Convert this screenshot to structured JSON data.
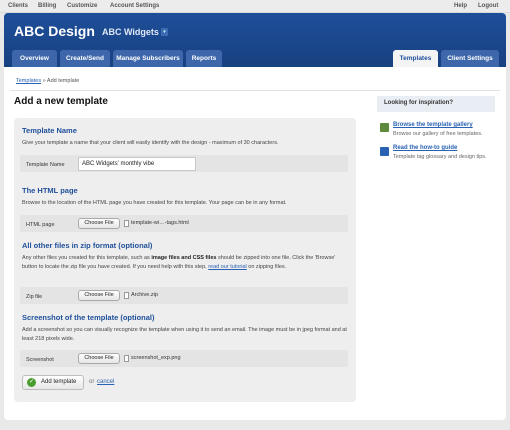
{
  "topnav": {
    "items": [
      "Clients",
      "Billing",
      "Customize",
      "Account Settings"
    ],
    "help": "Help",
    "logout": "Logout"
  },
  "header": {
    "title": "ABC Design",
    "client": "ABC Widgets"
  },
  "tabs": {
    "overview": "Overview",
    "create_send": "Create/Send",
    "manage_subscribers": "Manage Subscribers",
    "reports": "Reports",
    "templates": "Templates",
    "client_settings": "Client Settings"
  },
  "breadcrumb": {
    "parent": "Templates",
    "sep": "»",
    "current": "Add template"
  },
  "page": {
    "title": "Add a new template"
  },
  "form": {
    "name": {
      "heading": "Template Name",
      "help": "Give your template a name that your client will easily identify with the design - maximum of 30 characters.",
      "label": "Template Name",
      "value": "ABC Widgets' monthly vibe"
    },
    "html": {
      "heading": "The HTML page",
      "help": "Browse to the location of the HTML page you have created for this template. Your page can be in any format.",
      "label": "HTML page",
      "button": "Choose File",
      "filename": "template-wi…-tags.html"
    },
    "zip": {
      "heading": "All other files in zip format (optional)",
      "help_1": "Any other files you created for this template, such as ",
      "help_b1": "image files and CSS files",
      "help_2": " should be zipped into one file. Click the 'Browse' button to locate the zip file you have created. If you need help with this step, ",
      "help_link": "read our tutorial",
      "help_3": " on zipping files.",
      "label": "Zip file",
      "button": "Choose File",
      "filename": "Archive.zip"
    },
    "screenshot": {
      "heading": "Screenshot of the template (optional)",
      "help": "Add a screenshot so you can visually recognize the template when using it to send an email. The image must be in jpeg format and at least 218 pixels wide.",
      "label": "Screenshot",
      "button": "Choose File",
      "filename": "screenshot_exp.png"
    },
    "submit": "Add template",
    "or": "or",
    "cancel": "cancel"
  },
  "sidebar": {
    "heading": "Looking for inspiration?",
    "links": [
      {
        "label": "Browse the template gallery",
        "desc": "Browse our gallery of free templates."
      },
      {
        "label": "Read the how-to guide",
        "desc": "Template tag glossary and design tips."
      }
    ]
  },
  "colors": {
    "brand": "#1f4f9a",
    "link": "#2a62b3",
    "tab": "#3d67aa"
  }
}
